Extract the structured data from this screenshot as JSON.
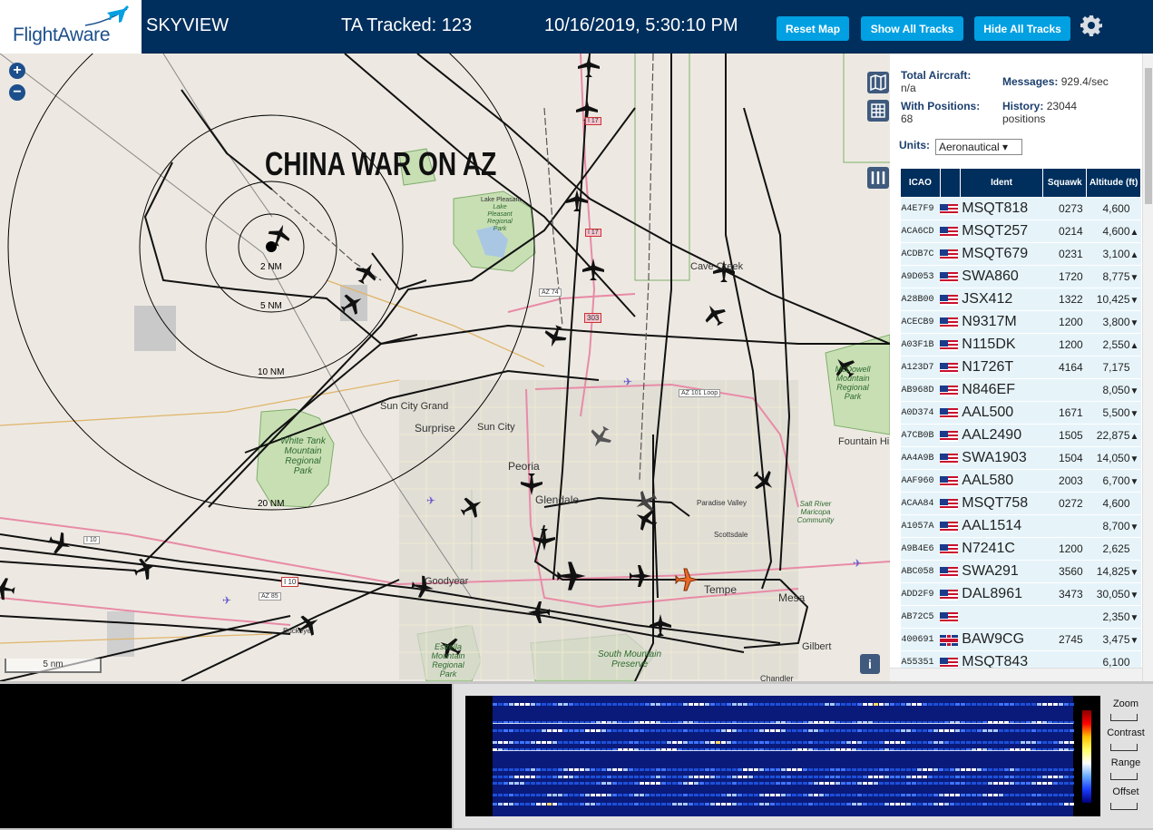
{
  "header": {
    "logo_text": "FlightAware",
    "app_name": "SKYVIEW",
    "tracked": "TA Tracked: 123",
    "datetime": "10/16/2019, 5:30:10 PM",
    "buttons": {
      "reset": "Reset Map",
      "show": "Show All Tracks",
      "hide": "Hide All Tracks"
    },
    "settings_icon": "gear-icon"
  },
  "map": {
    "overlay_title": "CHINA WAR ON AZ",
    "zoom_in": "+",
    "zoom_out": "−",
    "scale": "5 nm",
    "info": "i",
    "rings": [
      "2 NM",
      "5 NM",
      "10 NM",
      "20 NM"
    ],
    "places": [
      "Cave Creek",
      "Sun City Grand",
      "Surprise",
      "Sun City",
      "Peoria",
      "Glendale",
      "Goodyear",
      "Tempe",
      "Mesa",
      "Scottsdale",
      "Paradise Valley",
      "Fountain Hi",
      "Gilbert",
      "Buckeye",
      "Lake Pleasant",
      "Chandler"
    ],
    "parks": [
      "White Tank\nMountain\nRegional\nPark",
      "South Mountain\nPreserve",
      "Estrella\nMountain\nRegional\nPark",
      "McDowell\nMountain\nRegional\nPark",
      "Lake Pleasant\nRegional\nPark",
      "Salt River\nMaricopa\nCommunity"
    ],
    "highways": [
      "I 10",
      "I 10",
      "AZ 85",
      "AZ 74",
      "AZ 101 Loop",
      "I 17",
      "I 17",
      "303"
    ],
    "colors": {
      "land": "#ede9e2",
      "park": "#c8dfb4",
      "urban": "#dcd8d2",
      "range_ring": "#000000",
      "selected_aircraft": "#e86a2a"
    }
  },
  "sidebar": {
    "total_aircraft_label": "Total Aircraft:",
    "total_aircraft_value": "n/a",
    "with_positions_label": "With Positions:",
    "with_positions_value": "68",
    "messages_label": "Messages:",
    "messages_value": "929.4/sec",
    "history_label": "History:",
    "history_value": "23044 positions",
    "units_label": "Units:",
    "units_value": "Aeronautical ▾",
    "columns": [
      "ICAO",
      "",
      "Ident",
      "Squawk",
      "Altitude (ft)"
    ],
    "rows": [
      {
        "icao": "A4E7F9",
        "flag": "us",
        "ident": "MSQT818",
        "squawk": "0273",
        "alt": "4,600",
        "trend": ""
      },
      {
        "icao": "ACA6CD",
        "flag": "us",
        "ident": "MSQT257",
        "squawk": "0214",
        "alt": "4,600",
        "trend": "▲"
      },
      {
        "icao": "ACDB7C",
        "flag": "us",
        "ident": "MSQT679",
        "squawk": "0231",
        "alt": "3,100",
        "trend": "▲"
      },
      {
        "icao": "A9D053",
        "flag": "us",
        "ident": "SWA860",
        "squawk": "1720",
        "alt": "8,775",
        "trend": "▼"
      },
      {
        "icao": "A28B00",
        "flag": "us",
        "ident": "JSX412",
        "squawk": "1322",
        "alt": "10,425",
        "trend": "▼"
      },
      {
        "icao": "ACECB9",
        "flag": "us",
        "ident": "N9317M",
        "squawk": "1200",
        "alt": "3,800",
        "trend": "▼"
      },
      {
        "icao": "A03F1B",
        "flag": "us",
        "ident": "N115DK",
        "squawk": "1200",
        "alt": "2,550",
        "trend": "▲"
      },
      {
        "icao": "A123D7",
        "flag": "us",
        "ident": "N1726T",
        "squawk": "4164",
        "alt": "7,175",
        "trend": ""
      },
      {
        "icao": "AB968D",
        "flag": "us",
        "ident": "N846EF",
        "squawk": "",
        "alt": "8,050",
        "trend": "▼"
      },
      {
        "icao": "A0D374",
        "flag": "us",
        "ident": "AAL500",
        "squawk": "1671",
        "alt": "5,500",
        "trend": "▼"
      },
      {
        "icao": "A7CB0B",
        "flag": "us",
        "ident": "AAL2490",
        "squawk": "1505",
        "alt": "22,875",
        "trend": "▲"
      },
      {
        "icao": "AA4A9B",
        "flag": "us",
        "ident": "SWA1903",
        "squawk": "1504",
        "alt": "14,050",
        "trend": "▼"
      },
      {
        "icao": "AAF960",
        "flag": "us",
        "ident": "AAL580",
        "squawk": "2003",
        "alt": "6,700",
        "trend": "▼"
      },
      {
        "icao": "ACAA84",
        "flag": "us",
        "ident": "MSQT758",
        "squawk": "0272",
        "alt": "4,600",
        "trend": ""
      },
      {
        "icao": "A1057A",
        "flag": "us",
        "ident": "AAL1514",
        "squawk": "",
        "alt": "8,700",
        "trend": "▼"
      },
      {
        "icao": "A9B4E6",
        "flag": "us",
        "ident": "N7241C",
        "squawk": "1200",
        "alt": "2,625",
        "trend": ""
      },
      {
        "icao": "ABC058",
        "flag": "us",
        "ident": "SWA291",
        "squawk": "3560",
        "alt": "14,825",
        "trend": "▼"
      },
      {
        "icao": "ADD2F9",
        "flag": "us",
        "ident": "DAL8961",
        "squawk": "3473",
        "alt": "30,050",
        "trend": "▼"
      },
      {
        "icao": "AB72C5",
        "flag": "us",
        "ident": "",
        "squawk": "",
        "alt": "2,350",
        "trend": "▼"
      },
      {
        "icao": "400691",
        "flag": "uk",
        "ident": "BAW9CG",
        "squawk": "2745",
        "alt": "3,475",
        "trend": "▼"
      },
      {
        "icao": "A55351",
        "flag": "us",
        "ident": "MSQT843",
        "squawk": "",
        "alt": "6,100",
        "trend": ""
      }
    ]
  },
  "waterfall": {
    "labels": {
      "zoom": "Zoom",
      "contrast": "Contrast",
      "range": "Range",
      "offset": "Offset"
    }
  }
}
